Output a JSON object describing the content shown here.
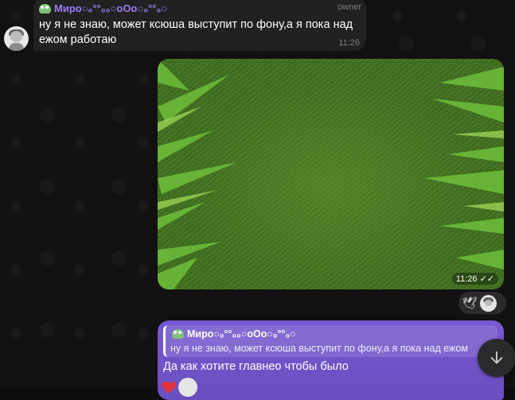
{
  "incoming": {
    "sender": "Миро○₀°°₀₀○оОо○₀°°₀○",
    "role": "owner",
    "text": "ну я не знаю, может ксюша выступит по фону,а я пока над ежом работаю",
    "time": "11:26"
  },
  "image_message": {
    "time": "11:26",
    "status_icon": "double-check-icon"
  },
  "reactions": {
    "emoji": "🕊",
    "avatar_icon": "user-avatar-icon"
  },
  "outgoing": {
    "reply_sender": "Миро○₀°°₀₀○оОо○₀°°₀○",
    "reply_text": "ну я не знаю, может ксюша выступит по фону,а я пока над ежом",
    "text": "Да как хотите главнео чтобы было",
    "reaction_icon": "heart-icon"
  },
  "fab": {
    "icon": "arrow-down-icon"
  },
  "colors": {
    "accent": "#9b7cf5",
    "outgoing_bubble": "#6f53c4",
    "incoming_bubble": "#212121"
  }
}
